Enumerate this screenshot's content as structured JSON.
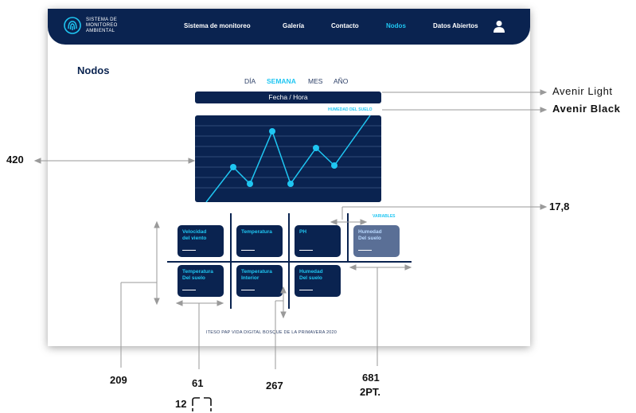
{
  "brand": {
    "line1": "SISTEMA DE",
    "line2": "MONITOREO",
    "line3": "AMBIENTAL"
  },
  "nav": {
    "items": [
      {
        "label": "Sistema de monitoreo"
      },
      {
        "label": "Galería"
      },
      {
        "label": "Contacto"
      },
      {
        "label": "Nodos",
        "active": true
      },
      {
        "label": "Datos Abiertos"
      }
    ]
  },
  "page": {
    "title": "Nodos",
    "tabs": [
      {
        "label": "DÍA"
      },
      {
        "label": "SEMANA",
        "active": true
      },
      {
        "label": "MES"
      },
      {
        "label": "AÑO"
      }
    ],
    "date_bar": "Fecha / Hora",
    "series_label": "HUMEDAD DEL SUELO",
    "variables_label": "VARIABLES",
    "variables": [
      {
        "label": "Velocidad\ndel viento"
      },
      {
        "label": "Temperatura"
      },
      {
        "label": "PH"
      },
      {
        "label": "Humedad\nDel suelo",
        "selected": true
      },
      {
        "label": "Temperatura\nDel suelo"
      },
      {
        "label": "Temperatura\nInterior"
      },
      {
        "label": "Humedad\nDel suelo"
      }
    ],
    "footer": "ITESO PAP VIDA DIGITAL BOSQUE DE LA PRIMAVERA 2020"
  },
  "colors": {
    "navy": "#0a2350",
    "accent": "#1fc6f2",
    "selected_card": "#5a6f96"
  },
  "icons": {
    "logo": "fingerprint-logo-icon",
    "user": "user-icon"
  },
  "annotations": {
    "font_light": "Avenir Light",
    "font_black": "Avenir Black",
    "chart_height": "420",
    "spacing": "17,8",
    "row_height": "209",
    "card_width": "61",
    "radius": "12",
    "gap": "267",
    "line_width": "681",
    "stroke": "2PT."
  }
}
